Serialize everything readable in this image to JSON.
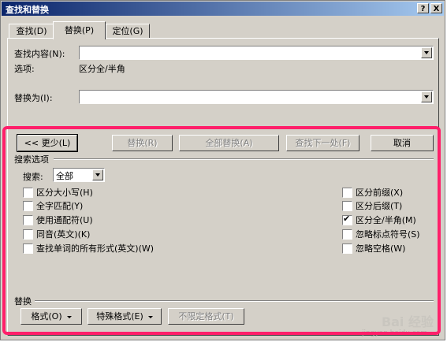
{
  "window": {
    "title": "查找和替换",
    "help_btn": "?",
    "close_btn": "X"
  },
  "tabs": [
    {
      "label": "查找(D)"
    },
    {
      "label": "替换(P)"
    },
    {
      "label": "定位(G)"
    }
  ],
  "find": {
    "label": "查找内容(N):",
    "value": "",
    "options_label": "选项:",
    "options_value": "区分全/半角"
  },
  "replace": {
    "label": "替换为(I):",
    "value": ""
  },
  "buttons": {
    "less": "<< 更少(L)",
    "replace": "替换(R)",
    "replace_all": "全部替换(A)",
    "find_next": "查找下一处(F)",
    "cancel": "取消"
  },
  "search_options": {
    "group_label": "搜索选项",
    "search_label": "搜索:",
    "search_value": "全部",
    "left_checks": [
      {
        "label": "区分大小写(H)",
        "checked": false
      },
      {
        "label": "全字匹配(Y)",
        "checked": false
      },
      {
        "label": "使用通配符(U)",
        "checked": false
      },
      {
        "label": "同音(英文)(K)",
        "checked": false
      },
      {
        "label": "查找单词的所有形式(英文)(W)",
        "checked": false
      }
    ],
    "right_checks": [
      {
        "label": "区分前缀(X)",
        "checked": false
      },
      {
        "label": "区分后缀(T)",
        "checked": false
      },
      {
        "label": "区分全/半角(M)",
        "checked": true
      },
      {
        "label": "忽略标点符号(S)",
        "checked": false
      },
      {
        "label": "忽略空格(W)",
        "checked": false
      }
    ]
  },
  "replace_group": {
    "label": "替换",
    "format_btn": "格式(O)",
    "special_btn": "特殊格式(E)",
    "noformat_btn": "不限定格式(T)"
  },
  "watermark": {
    "text": "Bai 经验",
    "url": "jingyan.baidu.com"
  },
  "colors": {
    "face": "#d4d0c8",
    "title_start": "#0a246a",
    "title_end": "#a6caf0",
    "highlight": "#ff1f6a"
  }
}
